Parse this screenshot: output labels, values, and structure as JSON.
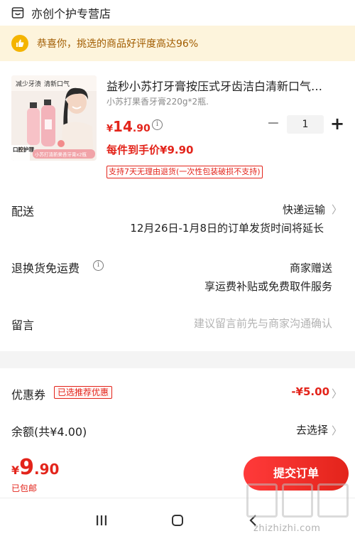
{
  "store": {
    "name": "亦创个护专营店",
    "icon": "store-icon"
  },
  "notice": {
    "text": "恭喜你，挑选的商品好评度高达96%",
    "icon": "thumbs-up-icon",
    "color": "#a15c00",
    "bg": "#fdf4dc"
  },
  "product": {
    "image_texts": {
      "banner_left": "减少牙渍",
      "banner_right": "清新口气",
      "side_label": "口腔护理",
      "badge": "小苏打清新果香牙膏x2瓶"
    },
    "title": "益秒小苏打牙膏按压式牙齿洁白清新口气…",
    "spec": "小苏打果香牙膏220g*2瓶.",
    "price": {
      "currency": "¥",
      "integer": "14",
      "decimal": ".90"
    },
    "final_price_label": "每件到手价¥9.90",
    "return_policy": "支持7天无理由退货(一次性包装破损不支持)",
    "quantity": {
      "minus": "−",
      "value": "1",
      "plus": "+"
    }
  },
  "delivery": {
    "label": "配送",
    "method": "快递运输",
    "note": "12月26日-1月8日的订单发货时间将延长"
  },
  "return_shipping": {
    "label": "退换货免运费",
    "value": "商家赠送",
    "note": "享运费补贴或免费取件服务"
  },
  "message": {
    "label": "留言",
    "placeholder": "建议留言前先与商家沟通确认"
  },
  "coupon": {
    "label": "优惠券",
    "tag": "已选推荐优惠",
    "amount": "-¥5.00"
  },
  "balance": {
    "label": "余额(共¥4.00)",
    "action": "去选择"
  },
  "footer": {
    "currency": "¥",
    "total_integer": "9",
    "total_decimal": ".90",
    "shipping_note": "已包邮",
    "submit_label": "提交订单"
  },
  "navbar": {
    "items": [
      "recent-apps-icon",
      "home-icon",
      "back-icon"
    ]
  },
  "watermark": {
    "text": "zhizhizhi.com"
  },
  "colors": {
    "accent_red": "#e3241b",
    "notice_text": "#a15c00",
    "muted": "#8a8a8a"
  }
}
